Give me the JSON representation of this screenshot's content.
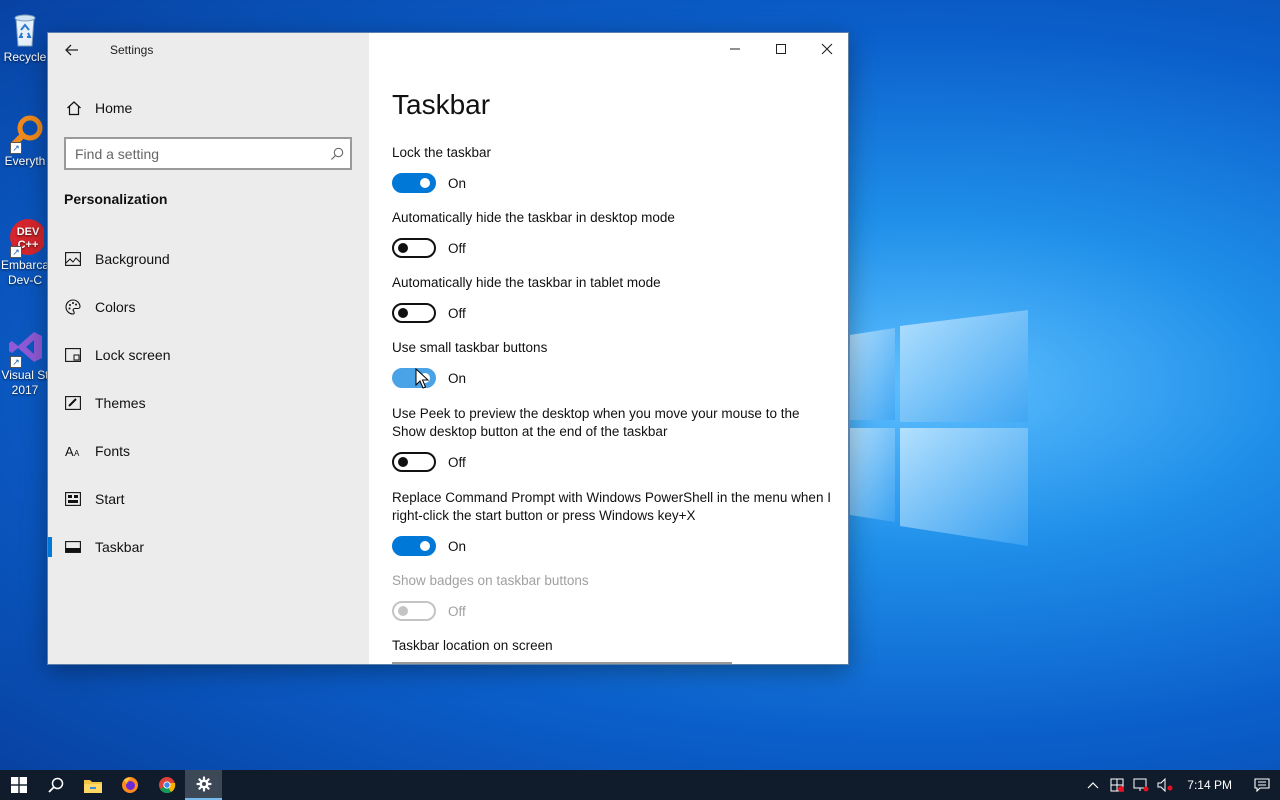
{
  "desktop": {
    "icons": [
      {
        "label": "Recycle",
        "icon": "recycle-bin-icon"
      },
      {
        "label": "Everyth",
        "icon": "everything-search-icon"
      },
      {
        "label": "Embarca Dev-C",
        "icon": "dev-cpp-icon"
      },
      {
        "label": "Visual St 2017",
        "icon": "visual-studio-icon"
      }
    ]
  },
  "window": {
    "app_title": "Settings",
    "home_label": "Home",
    "search_placeholder": "Find a setting",
    "section_title": "Personalization",
    "nav": [
      {
        "label": "Background",
        "icon": "picture-icon"
      },
      {
        "label": "Colors",
        "icon": "palette-icon"
      },
      {
        "label": "Lock screen",
        "icon": "lock-screen-icon"
      },
      {
        "label": "Themes",
        "icon": "brush-icon"
      },
      {
        "label": "Fonts",
        "icon": "font-icon"
      },
      {
        "label": "Start",
        "icon": "start-icon"
      },
      {
        "label": "Taskbar",
        "icon": "taskbar-icon",
        "active": true
      }
    ],
    "page_title": "Taskbar",
    "settings": [
      {
        "label": "Lock the taskbar",
        "state": "On"
      },
      {
        "label": "Automatically hide the taskbar in desktop mode",
        "state": "Off"
      },
      {
        "label": "Automatically hide the taskbar in tablet mode",
        "state": "Off"
      },
      {
        "label": "Use small taskbar buttons",
        "state": "On"
      },
      {
        "label": "Use Peek to preview the desktop when you move your mouse to the Show desktop button at the end of the taskbar",
        "state": "Off"
      },
      {
        "label": "Replace Command Prompt with Windows PowerShell in the menu when I right-click the start button or press Windows key+X",
        "state": "On"
      },
      {
        "label": "Show badges on taskbar buttons",
        "state": "Off",
        "disabled": true
      },
      {
        "label": "Taskbar location on screen"
      }
    ]
  },
  "taskbar": {
    "clock": "7:14 PM",
    "accent": "#76b9ed",
    "items": [
      "windows-start-icon",
      "search-icon",
      "file-explorer-icon",
      "firefox-icon",
      "chrome-icon",
      "settings-gear-icon"
    ]
  },
  "colors": {
    "accent": "#0078d7"
  }
}
